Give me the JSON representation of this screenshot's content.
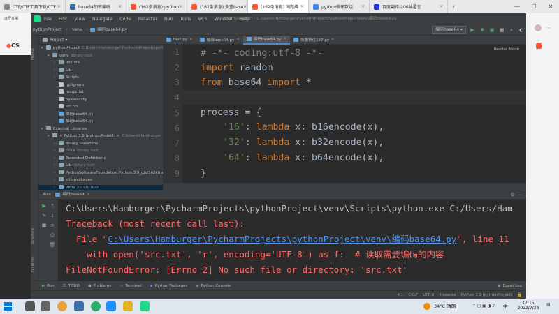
{
  "browser": {
    "tabs": [
      {
        "label": "CTF/CTF工具下载/CTF",
        "color": "#888888",
        "active": false
      },
      {
        "label": "base64加密编码",
        "color": "#3b6ea5",
        "active": false
      },
      {
        "label": "(162条消息) python",
        "color": "#fc5531",
        "active": false
      },
      {
        "label": "(162条消息) 多重base",
        "color": "#fc5531",
        "active": false
      },
      {
        "label": "(162条消息) 问题描",
        "color": "#fc5531",
        "active": true
      },
      {
        "label": "python循环数组",
        "color": "#4285f4",
        "active": false
      },
      {
        "label": "百度翻译-200种语言",
        "color": "#2932e1",
        "active": false
      }
    ],
    "bookmark": "虎牙直播",
    "csdn": "CS"
  },
  "ide": {
    "menu": [
      "File",
      "Edit",
      "View",
      "Navigate",
      "Code",
      "Refactor",
      "Run",
      "Tools",
      "VCS",
      "Window",
      "Help"
    ],
    "window_title": "pythonProject - C:\\Users\\Hamburger\\PycharmProjects\\pythonProject\\venv\\编码base64.py",
    "breadcrumbs": [
      "pythonProject",
      "venv",
      "编码base64.py"
    ],
    "run_config": "编码base64",
    "project_label": "Project",
    "tree": [
      {
        "indent": 0,
        "arrow": "▾",
        "icon": "folder",
        "name": "pythonProject",
        "extra": "C:\\Users\\Hamburger\\PycharmProjects\\pythonProject"
      },
      {
        "indent": 1,
        "arrow": "▾",
        "icon": "folderb",
        "name": "venv",
        "extra": "library root"
      },
      {
        "indent": 2,
        "arrow": "›",
        "icon": "folder",
        "name": "Include",
        "extra": ""
      },
      {
        "indent": 2,
        "arrow": "›",
        "icon": "folder",
        "name": "Lib",
        "extra": ""
      },
      {
        "indent": 2,
        "arrow": "›",
        "icon": "folder",
        "name": "Scripts",
        "extra": ""
      },
      {
        "indent": 2,
        "arrow": "",
        "icon": "txtf",
        "name": ".gitignore",
        "extra": ""
      },
      {
        "indent": 2,
        "arrow": "",
        "icon": "txtf",
        "name": "magic.txt",
        "extra": ""
      },
      {
        "indent": 2,
        "arrow": "",
        "icon": "txtf",
        "name": "pyvenv.cfg",
        "extra": ""
      },
      {
        "indent": 2,
        "arrow": "",
        "icon": "txtf",
        "name": "src.txt",
        "extra": ""
      },
      {
        "indent": 2,
        "arrow": "",
        "icon": "pyf",
        "name": "编码base64.py",
        "extra": ""
      },
      {
        "indent": 2,
        "arrow": "",
        "icon": "pyf",
        "name": "解码base64.py",
        "extra": ""
      },
      {
        "indent": 0,
        "arrow": "▾",
        "icon": "folder",
        "name": "External Libraries",
        "extra": ""
      },
      {
        "indent": 1,
        "arrow": "▾",
        "icon": "folder",
        "name": "< Python 3.9 (pythonProject) >",
        "extra": "C:\\Users\\Hamburger"
      },
      {
        "indent": 2,
        "arrow": "›",
        "icon": "folder",
        "name": "Binary Skeletons",
        "extra": ""
      },
      {
        "indent": 2,
        "arrow": "›",
        "icon": "folder",
        "name": "DLLs",
        "extra": "library root"
      },
      {
        "indent": 2,
        "arrow": "›",
        "icon": "folder",
        "name": "Extended Definitions",
        "extra": ""
      },
      {
        "indent": 2,
        "arrow": "›",
        "icon": "folder",
        "name": "Lib",
        "extra": "library root"
      },
      {
        "indent": 2,
        "arrow": "›",
        "icon": "folder",
        "name": "PythonSoftwareFoundation.Python.3.9_qbz5n2kfra8p0",
        "extra": ""
      },
      {
        "indent": 2,
        "arrow": "›",
        "icon": "folder",
        "name": "site-packages",
        "extra": ""
      },
      {
        "indent": 2,
        "arrow": "›",
        "icon": "folderb",
        "name": "venv",
        "extra": "library root",
        "selected": true
      }
    ],
    "editor_tabs": [
      {
        "label": "task.py",
        "active": false
      },
      {
        "label": "解码base64.py",
        "active": false
      },
      {
        "label": "编码base64.py",
        "active": true
      },
      {
        "label": "凯撒移位127.py",
        "active": false
      }
    ],
    "reader_mode": "Reader Mode",
    "line_numbers": [
      "1",
      "2",
      "3",
      "4",
      "5",
      "6",
      "7",
      "8",
      "9"
    ],
    "code": {
      "l1": "# -*- coding:utf-8 -*-",
      "l2_kw": "import",
      "l2_rest": " random",
      "l3_kw1": "from",
      "l3_mid": " base64 ",
      "l3_kw2": "import",
      "l3_rest": " *",
      "l5": "process = {",
      "l6_str": "'16'",
      "l6_mid": ": ",
      "l6_kw": "lambda",
      "l6_rest": " x: b16encode(x),",
      "l7_str": "'32'",
      "l7_mid": ": ",
      "l7_kw": "lambda",
      "l7_rest": " x: b32encode(x),",
      "l8_str": "'64'",
      "l8_mid": ": ",
      "l8_kw": "lambda",
      "l8_rest": " x: b64encode(x),",
      "l9": "}"
    },
    "run": {
      "tab": "编码base64",
      "line1": "C:\\Users\\Hamburger\\PycharmProjects\\pythonProject\\venv\\Scripts\\python.exe C:/Users/Ham",
      "line2": "Traceback (most recent call last):",
      "line3_a": "  File \"",
      "line3_link": "C:\\Users\\Hamburger\\PycharmProjects\\pythonProject\\venv\\编码base64.py",
      "line3_b": "\", line 11",
      "line4": "    with open('src.txt', 'r', encoding='UTF-8') as f:  # 读取需要编码的内容",
      "line5": "FileNotFoundError: [Errno 2] No such file or directory: 'src.txt'"
    },
    "bottom_tools": [
      "Run",
      "TODO",
      "Problems",
      "Terminal",
      "Python Packages",
      "Python Console"
    ],
    "event_log": "Event Log",
    "status": {
      "pos": "4:1",
      "eol": "CRLF",
      "enc": "UTF-8",
      "indent": "4 spaces",
      "interp": "Python 3.9 (pythonProject)"
    },
    "side_labels": {
      "structure": "Structure",
      "favorites": "Favorites",
      "project": "Project"
    }
  },
  "taskbar": {
    "weather": "34°C 晴朗",
    "lang": "中",
    "time": "17:15",
    "date": "2022/7/28"
  }
}
